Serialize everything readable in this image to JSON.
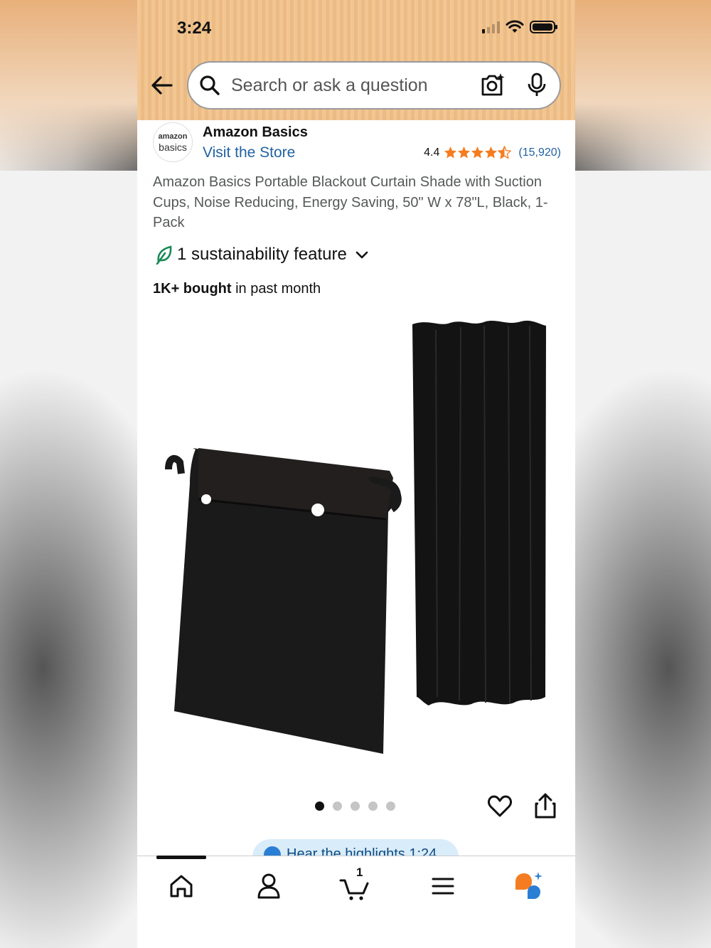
{
  "status_bar": {
    "time": "3:24"
  },
  "search": {
    "placeholder": "Search or ask a question"
  },
  "brand": {
    "logo_line1": "amazon",
    "logo_line2": "basics",
    "name": "Amazon Basics",
    "store_link": "Visit the Store",
    "rating": "4.4",
    "rating_value": 4.4,
    "rating_count": "(15,920)"
  },
  "product": {
    "title": "Amazon Basics Portable Blackout Curtain Shade with Suction Cups, Noise Reducing, Energy Saving, 50\" W x 78\"L, Black, 1-Pack",
    "sustainability": "1 sustainability feature",
    "bought_bold": "1K+ bought",
    "bought_rest": " in past month"
  },
  "carousel": {
    "total_images": 5,
    "active_index": 0
  },
  "highlights": {
    "label": "Hear the highlights 1:24"
  },
  "bottom_nav": {
    "cart_count": "1",
    "items": [
      "home",
      "account",
      "cart",
      "menu",
      "rufus"
    ]
  },
  "colors": {
    "header_bg": "#f2c692",
    "link_blue": "#2162a1",
    "star_orange": "#f57c20",
    "leaf_green": "#1a8a55"
  }
}
